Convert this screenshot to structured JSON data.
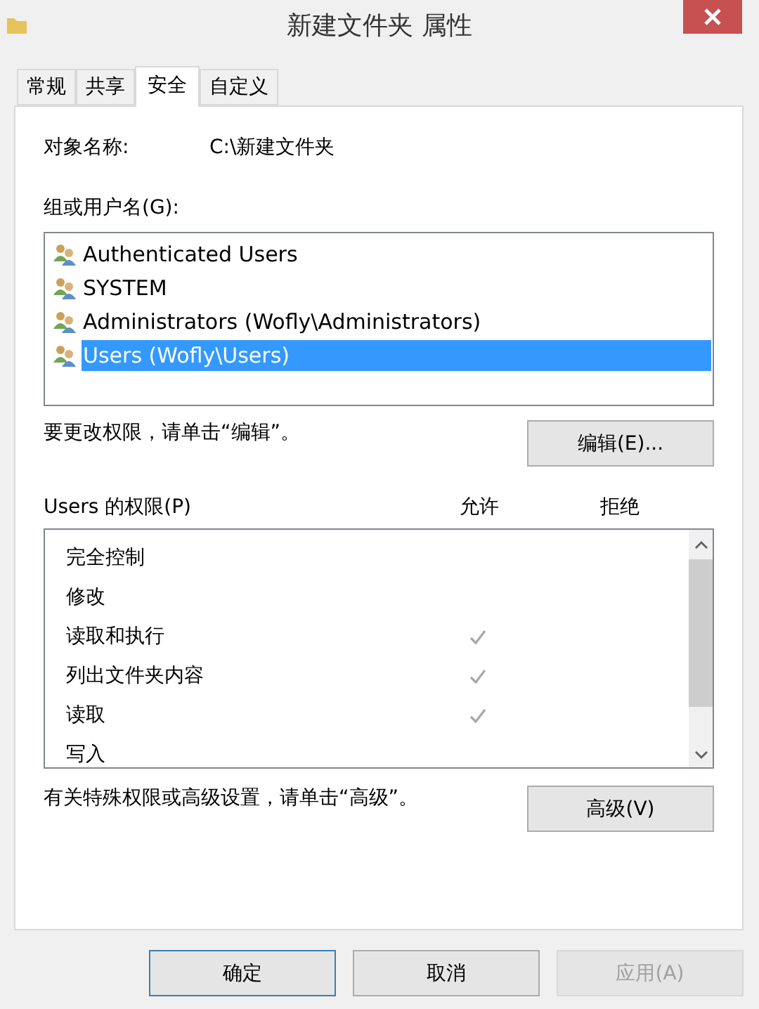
{
  "window": {
    "title": "新建文件夹 属性"
  },
  "tabs": [
    {
      "label": "常规",
      "selected": false
    },
    {
      "label": "共享",
      "selected": false
    },
    {
      "label": "安全",
      "selected": true
    },
    {
      "label": "自定义",
      "selected": false
    }
  ],
  "object_name": {
    "label": "对象名称:",
    "value": "C:\\新建文件夹"
  },
  "users_label": "组或用户名(G):",
  "users": [
    {
      "name": "Authenticated Users",
      "selected": false
    },
    {
      "name": "SYSTEM",
      "selected": false
    },
    {
      "name": "Administrators (Wofly\\Administrators)",
      "selected": false
    },
    {
      "name": "Users (Wofly\\Users)",
      "selected": true
    }
  ],
  "edit_hint": "要更改权限，请单击“编辑”。",
  "edit_button": "编辑(E)...",
  "permissions_label": "Users 的权限(P)",
  "allow_header": "允许",
  "deny_header": "拒绝",
  "permissions": [
    {
      "name": "完全控制",
      "allow": false,
      "deny": false
    },
    {
      "name": "修改",
      "allow": false,
      "deny": false
    },
    {
      "name": "读取和执行",
      "allow": true,
      "deny": false
    },
    {
      "name": "列出文件夹内容",
      "allow": true,
      "deny": false
    },
    {
      "name": "读取",
      "allow": true,
      "deny": false
    },
    {
      "name": "写入",
      "allow": false,
      "deny": false
    }
  ],
  "advanced_hint": "有关特殊权限或高级设置，请单击“高级”。",
  "advanced_button": "高级(V)",
  "buttons": [
    {
      "label": "确定",
      "kind": "default",
      "disabled": false
    },
    {
      "label": "取消",
      "kind": "normal",
      "disabled": false
    },
    {
      "label": "应用(A)",
      "kind": "normal",
      "disabled": true
    }
  ]
}
